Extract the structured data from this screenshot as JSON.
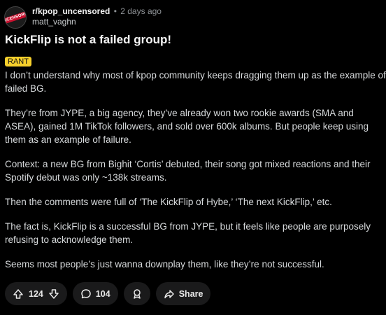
{
  "post": {
    "subreddit": "r/kpop_uncensored",
    "separator": "•",
    "time": "2 days ago",
    "author": "matt_vaghn",
    "avatar_text": "UNCENSORED",
    "title": "KickFlip is not a failed group!",
    "flair": "RANT",
    "paragraphs": [
      "I don’t understand why most of kpop community keeps dragging them up as the example of failed BG.",
      "They’re from JYPE, a big agency, they’ve already won two rookie awards (SMA and ASEA), gained 1M TikTok followers, and sold over 600k albums. But people keep using them as an example of failure.",
      "Context: a new BG from Bighit ‘Cortis’ debuted, their song got mixed reactions and their Spotify debut was only ~138k streams.",
      "Then the comments were full of ‘The KickFlip of Hybe,’ ‘The next KickFlip,’ etc.",
      "The fact is, KickFlip is a successful BG from JYPE, but it feels like people are purposely refusing to acknowledge them.",
      "Seems most people’s just wanna downplay them, like they’re not successful."
    ]
  },
  "actions": {
    "votes": "124",
    "comments": "104",
    "share": "Share"
  },
  "icons": {
    "upvote": "arrow-up-icon",
    "downvote": "arrow-down-icon",
    "comments": "comment-bubble-icon",
    "award": "award-icon",
    "share": "share-arrow-icon"
  },
  "colors": {
    "background": "#000000",
    "text": "#D7DADC",
    "flair_bg": "#F7D02C",
    "pill_bg": "#1A1A1B"
  }
}
